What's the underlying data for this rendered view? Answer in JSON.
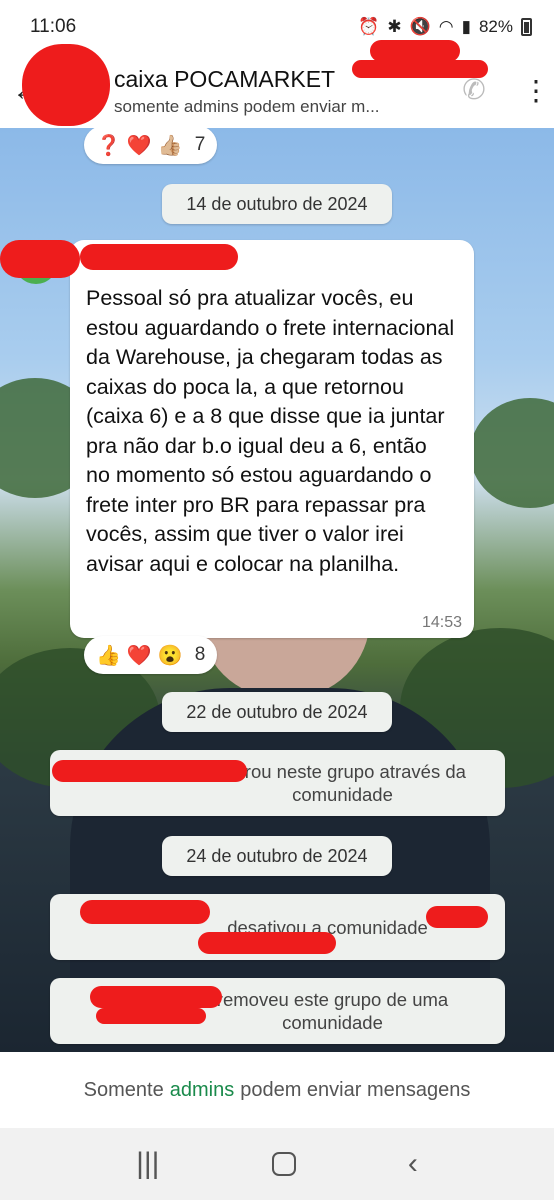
{
  "status_bar": {
    "time": "11:06",
    "battery": "82%"
  },
  "header": {
    "title": "caixa POCAMARKET",
    "subtitle": "somente admins podem enviar m..."
  },
  "chat": {
    "top_reactions": {
      "emojis": [
        "❓",
        "❤️",
        "👍🏼"
      ],
      "count": "7"
    },
    "date1": "14 de outubro de 2024",
    "message": {
      "text": "Pessoal só pra atualizar vocês, eu estou aguardando o frete internacional da Warehouse, ja chegaram todas as caixas do poca la, a que retornou (caixa 6) e a 8 que disse que ia juntar pra não dar b.o igual deu a 6, então no momento só estou aguardando o frete inter pro BR para repassar pra vocês, assim que tiver o valor irei avisar aqui e colocar na planilha.",
      "time": "14:53"
    },
    "message_reactions": {
      "emojis": [
        "👍",
        "❤️",
        "😮"
      ],
      "count": "8"
    },
    "date2": "22 de outubro de 2024",
    "system1": "entrou neste grupo através da comunidade",
    "date3": "24 de outubro de 2024",
    "system2": "desativou a comunidade",
    "system3": "removeu este grupo de uma comunidade"
  },
  "footer": {
    "before": "Somente",
    "accent": "admins",
    "after": "podem enviar mensagens",
    "accent_color": "#1a8a4b"
  }
}
